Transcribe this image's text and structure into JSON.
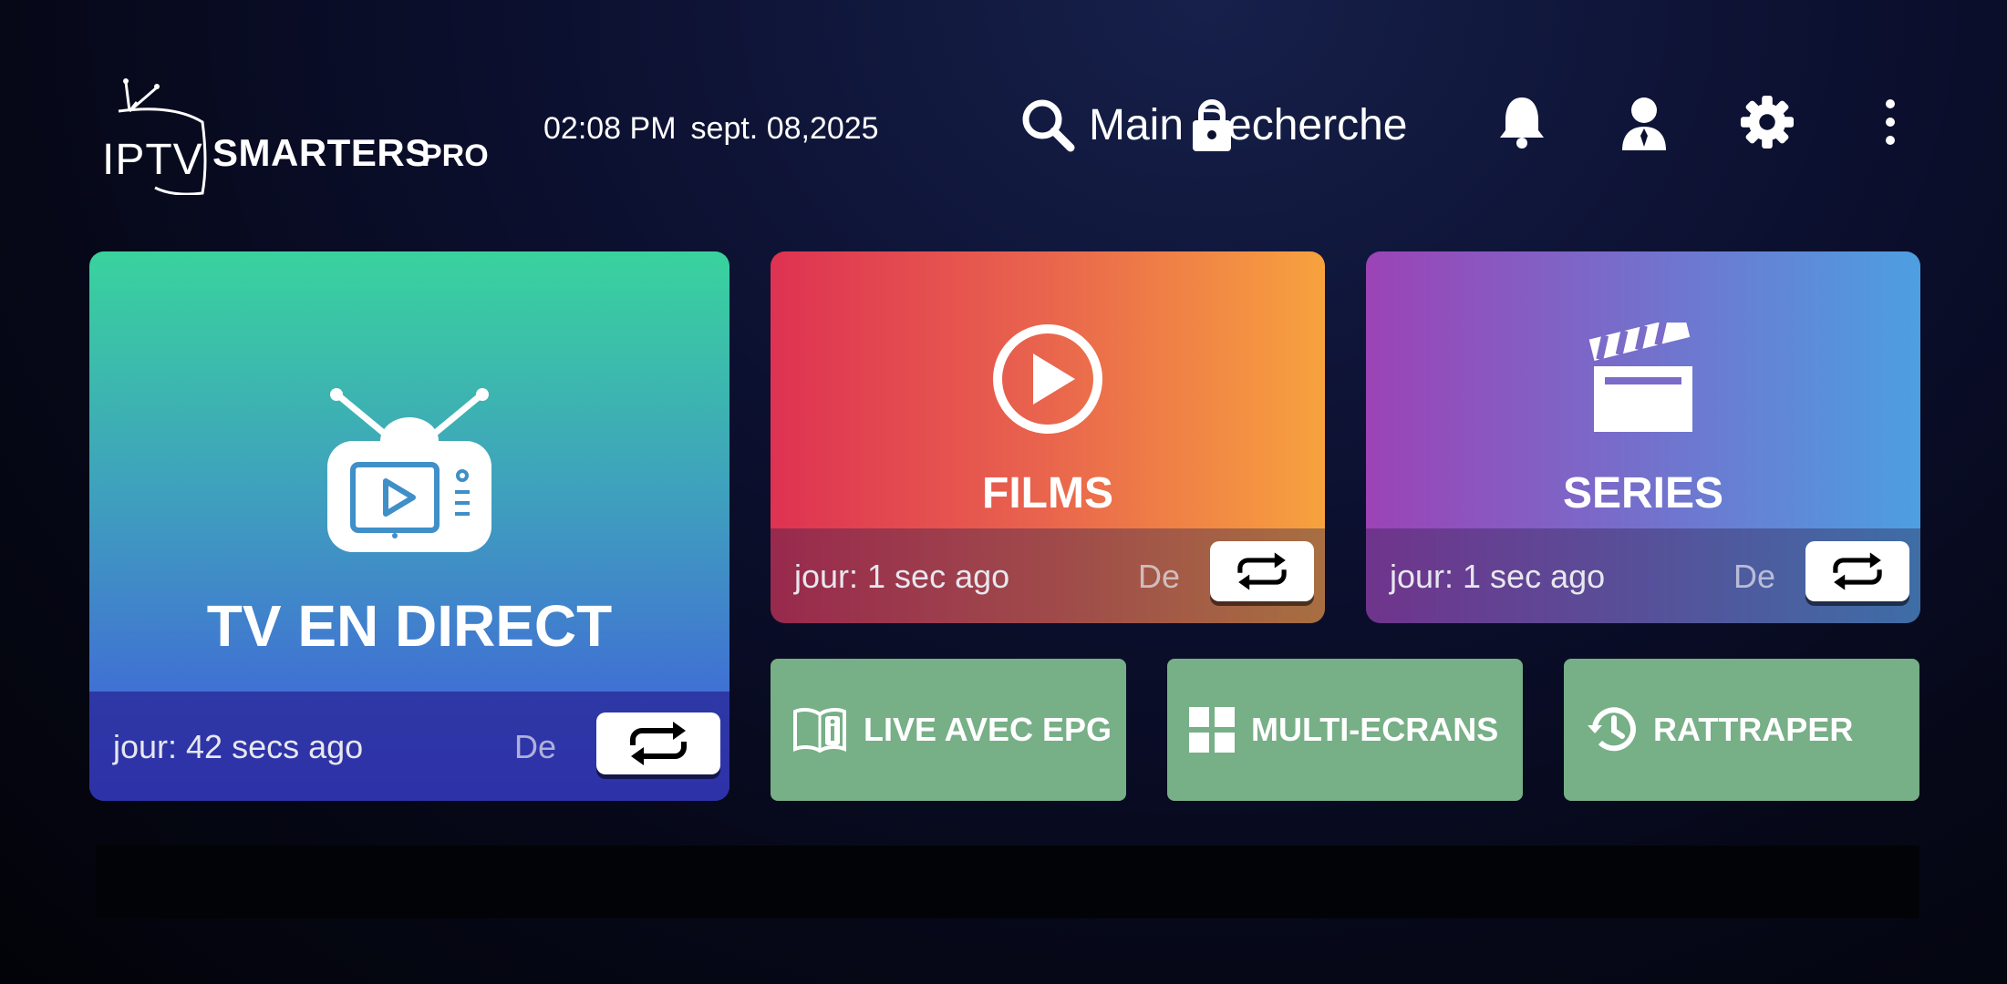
{
  "header": {
    "logo": {
      "iptv": "IPTV",
      "smarters": "SMARTERS",
      "pro": "PRO"
    },
    "time": "02:08 PM",
    "date": "sept. 08,2025",
    "search_label": "Main Recherche",
    "icons": [
      "bell-icon",
      "user-icon",
      "gear-icon",
      "more-icon"
    ]
  },
  "tiles": {
    "live": {
      "title": "TV EN DIRECT",
      "updated": "jour: 42 secs ago",
      "trunc": "De"
    },
    "films": {
      "title": "FILMS",
      "updated": "jour: 1 sec ago",
      "trunc": "De"
    },
    "series": {
      "title": "SERIES",
      "updated": "jour: 1 sec ago",
      "trunc": "De"
    }
  },
  "buttons": {
    "epg": "LIVE AVEC EPG",
    "multi": "MULTI-ECRANS",
    "catchup": "RATTRAPER"
  },
  "colors": {
    "live_top": "#39d39d",
    "live_bottom": "#4156e0",
    "films_left": "#de3252",
    "films_right": "#f7a23e",
    "series_left": "#9c43b6",
    "series_right": "#4d9fe1",
    "button_green": "#77af87"
  }
}
